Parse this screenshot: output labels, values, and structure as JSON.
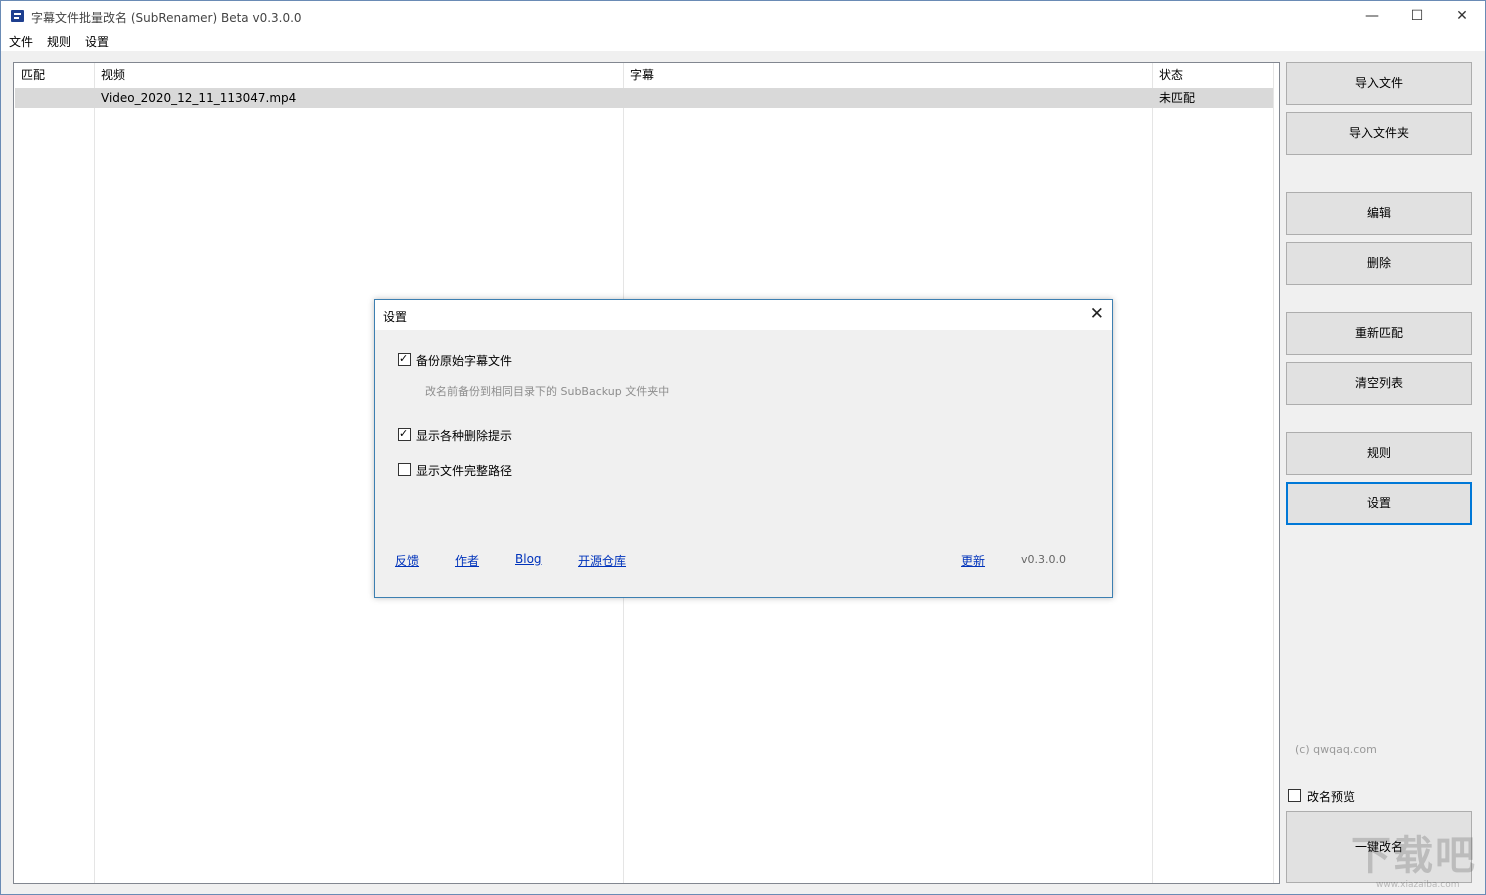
{
  "window": {
    "title": "字幕文件批量改名 (SubRenamer) Beta v0.3.0.0",
    "minimize_icon": "minimize-icon",
    "maximize_icon": "maximize-icon",
    "close_icon": "close-icon"
  },
  "menu": [
    "文件",
    "规则",
    "设置"
  ],
  "table": {
    "columns": [
      "匹配",
      "视频",
      "字幕",
      "状态"
    ],
    "rows": [
      {
        "match": "",
        "video": "Video_2020_12_11_113047.mp4",
        "subtitle": "",
        "status": "未匹配"
      }
    ]
  },
  "sidebar": {
    "buttons": [
      "导入文件",
      "导入文件夹",
      "编辑",
      "删除",
      "重新匹配",
      "清空列表",
      "规则",
      "设置"
    ],
    "copyright": "(c) qwqaq.com",
    "preview_label": "改名预览",
    "preview_checked": false,
    "rename_button": "一键改名"
  },
  "dialog": {
    "title": "设置",
    "options": [
      {
        "label": "备份原始字幕文件",
        "checked": true
      },
      {
        "label": "显示各种删除提示",
        "checked": true
      },
      {
        "label": "显示文件完整路径",
        "checked": false
      }
    ],
    "backup_hint": "改名前备份到相同目录下的 SubBackup 文件夹中",
    "links": [
      "反馈",
      "作者",
      "Blog",
      "开源仓库"
    ],
    "update_link": "更新",
    "version": "v0.3.0.0"
  },
  "watermark": {
    "text": "下载吧",
    "url": "www.xiazaiba.com"
  },
  "colors": {
    "accent": "#0078d7",
    "selected_row": "#d9d9d9",
    "link": "#0033bb"
  }
}
